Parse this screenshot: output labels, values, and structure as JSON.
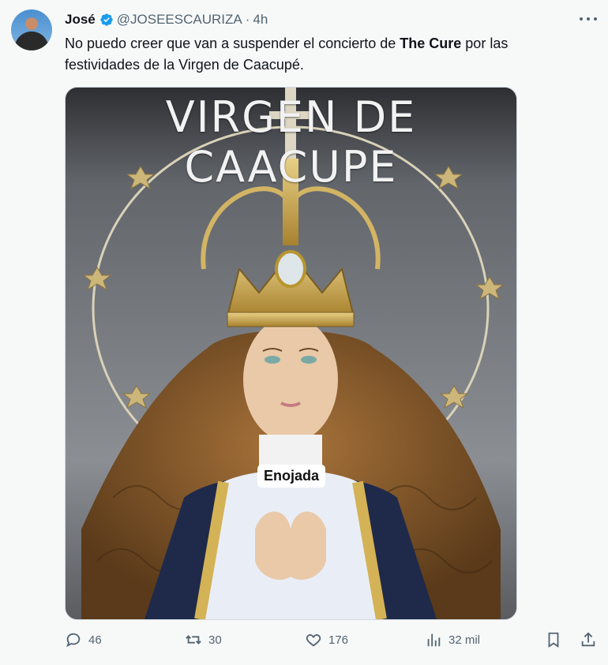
{
  "tweet": {
    "name": "José",
    "handle": "@JOSEESCAURIZA",
    "separator": "·",
    "time": "4h",
    "text_part1": "No puedo creer que van a suspender el concierto de ",
    "text_bold": "The Cure",
    "text_part2": " por las festividades de la Virgen de Caacupé."
  },
  "media": {
    "title": "VIRGEN DE CAACUPE",
    "caption": "Enojada"
  },
  "actions": {
    "replies": "46",
    "retweets": "30",
    "likes": "176",
    "views": "32 mil"
  },
  "colors": {
    "verified": "#1d9bf0",
    "muted": "#536471"
  }
}
